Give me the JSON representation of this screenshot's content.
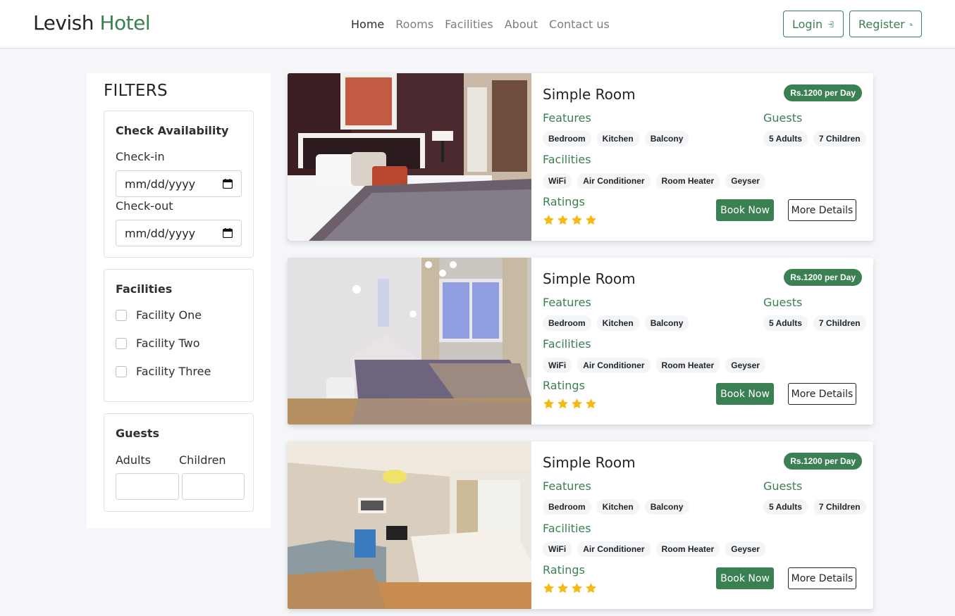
{
  "brand": {
    "name": "Levish",
    "accent": "Hotel"
  },
  "nav": {
    "links": [
      "Home",
      "Rooms",
      "Facilities",
      "About",
      "Contact us"
    ],
    "login_label": "Login",
    "register_label": "Register"
  },
  "filters": {
    "title": "FILTERS",
    "availability": {
      "title": "Check Availability",
      "checkin_label": "Check-in",
      "checkin_value": "mm/dd/yyyy",
      "checkout_label": "Check-out",
      "checkout_value": "mm/dd/yyyy"
    },
    "facilities": {
      "title": "Facilities",
      "options": [
        "Facility One",
        "Facility Two",
        "Facility Three"
      ]
    },
    "guests": {
      "title": "Guests",
      "adults_label": "Adults",
      "children_label": "Children"
    }
  },
  "rooms": [
    {
      "name": "Simple Room",
      "price": "Rs.1200 per Day",
      "features_label": "Features",
      "features": [
        "Bedroom",
        "Kitchen",
        "Balcony"
      ],
      "guests_label": "Guests",
      "guests": [
        "5 Adults",
        "7 Children"
      ],
      "facilities_label": "Facilities",
      "facilities": [
        "WiFi",
        "Air Conditioner",
        "Room Heater",
        "Geyser"
      ],
      "ratings_label": "Ratings",
      "rating": 4,
      "book_label": "Book Now",
      "details_label": "More Details"
    },
    {
      "name": "Simple Room",
      "price": "Rs.1200 per Day",
      "features_label": "Features",
      "features": [
        "Bedroom",
        "Kitchen",
        "Balcony"
      ],
      "guests_label": "Guests",
      "guests": [
        "5 Adults",
        "7 Children"
      ],
      "facilities_label": "Facilities",
      "facilities": [
        "WiFi",
        "Air Conditioner",
        "Room Heater",
        "Geyser"
      ],
      "ratings_label": "Ratings",
      "rating": 4,
      "book_label": "Book Now",
      "details_label": "More Details"
    },
    {
      "name": "Simple Room",
      "price": "Rs.1200 per Day",
      "features_label": "Features",
      "features": [
        "Bedroom",
        "Kitchen",
        "Balcony"
      ],
      "guests_label": "Guests",
      "guests": [
        "5 Adults",
        "7 Children"
      ],
      "facilities_label": "Facilities",
      "facilities": [
        "WiFi",
        "Air Conditioner",
        "Room Heater",
        "Geyser"
      ],
      "ratings_label": "Ratings",
      "rating": 4,
      "book_label": "Book Now",
      "details_label": "More Details"
    }
  ],
  "colors": {
    "accent": "#3a8053",
    "star": "#f5b914",
    "background": "#f4f6f9"
  }
}
